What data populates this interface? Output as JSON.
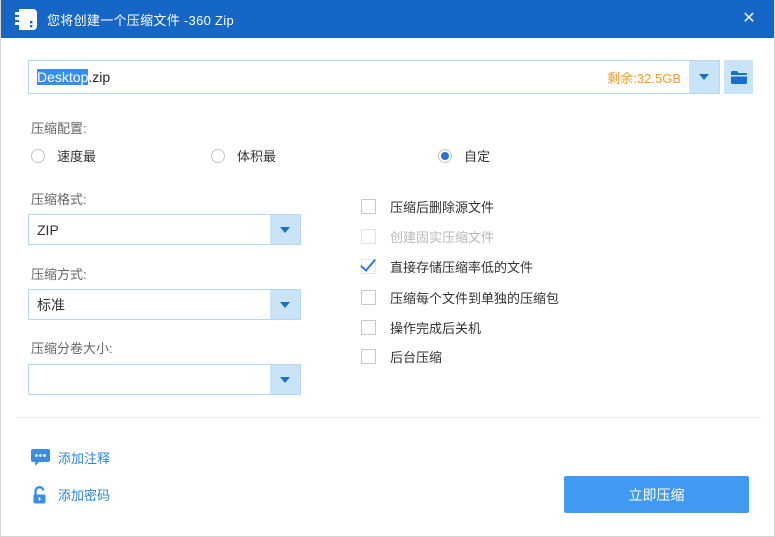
{
  "window": {
    "title": "您将创建一个压缩文件 -360 Zip",
    "close_glyph": "✕"
  },
  "filename": {
    "selected_part": "Desktop",
    "extension": ".zip",
    "free_space": "剩余:32.5GB"
  },
  "config": {
    "label": "压缩配置:",
    "options": [
      {
        "label": "速度最",
        "selected": false
      },
      {
        "label": "体积最",
        "selected": false
      },
      {
        "label": "自定",
        "selected": true
      }
    ]
  },
  "format": {
    "label": "压缩格式:",
    "value": "ZIP"
  },
  "method": {
    "label": "压缩方式:",
    "value": "标准"
  },
  "volume": {
    "label": "压缩分卷大小:",
    "value": ""
  },
  "checkboxes": [
    {
      "label": "压缩后删除源文件",
      "checked": false,
      "disabled": false
    },
    {
      "label": "创建固实压缩文件",
      "checked": false,
      "disabled": true
    },
    {
      "label": "直接存储压缩率低的文件",
      "checked": true,
      "disabled": false
    },
    {
      "label": "压缩每个文件到单独的压缩包",
      "checked": false,
      "disabled": false
    },
    {
      "label": "操作完成后关机",
      "checked": false,
      "disabled": false
    },
    {
      "label": "后台压缩",
      "checked": false,
      "disabled": false
    }
  ],
  "footer": {
    "add_comment": "添加注释",
    "add_password": "添加密码",
    "compress_button": "立即压缩"
  },
  "colors": {
    "titlebar": "#1666c5",
    "accent_blue": "#2e84d8",
    "light_blue_button": "#c9e3f7",
    "arrow_blue": "#1a6ec9",
    "free_space_orange": "#f59a23",
    "selection_highlight": "#3390f0",
    "primary_button": "#419af2",
    "input_border": "#b5d7f0"
  }
}
